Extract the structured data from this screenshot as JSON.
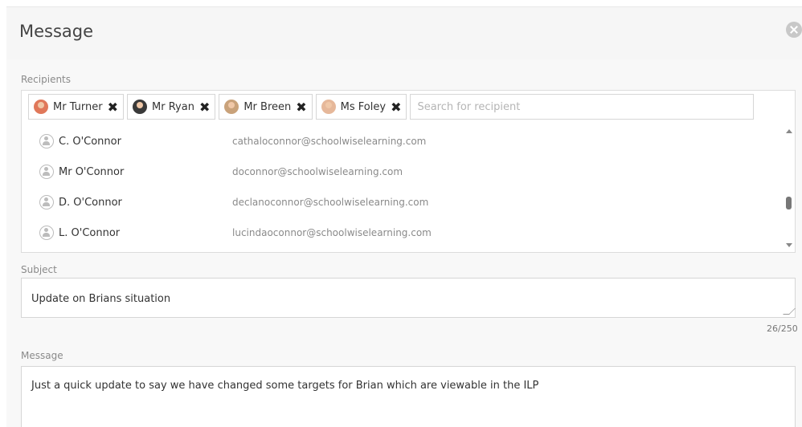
{
  "dialog": {
    "title": "Message"
  },
  "recipients": {
    "label": "Recipients",
    "selected": [
      {
        "name": "Mr Turner",
        "avatar_color": "#e0785a"
      },
      {
        "name": "Mr Ryan",
        "avatar_color": "#3a3a3a"
      },
      {
        "name": "Mr Breen",
        "avatar_color": "#c9a27a"
      },
      {
        "name": "Ms Foley",
        "avatar_color": "#e6b89a"
      }
    ],
    "search_placeholder": "Search for recipient",
    "results": [
      {
        "name": "C. O'Connor",
        "email": "cathaloconnor@schoolwiselearning.com"
      },
      {
        "name": "Mr O'Connor",
        "email": "doconnor@schoolwiselearning.com"
      },
      {
        "name": "D. O'Connor",
        "email": "declanoconnor@schoolwiselearning.com"
      },
      {
        "name": "L. O'Connor",
        "email": "lucindaoconnor@schoolwiselearning.com"
      }
    ],
    "remove_glyph": "✖"
  },
  "subject": {
    "label": "Subject",
    "value": "Update on Brians situation",
    "counter": "26/250"
  },
  "message": {
    "label": "Message",
    "value": "Just a quick update to say we have changed some targets for Brian which are viewable in the ILP"
  }
}
